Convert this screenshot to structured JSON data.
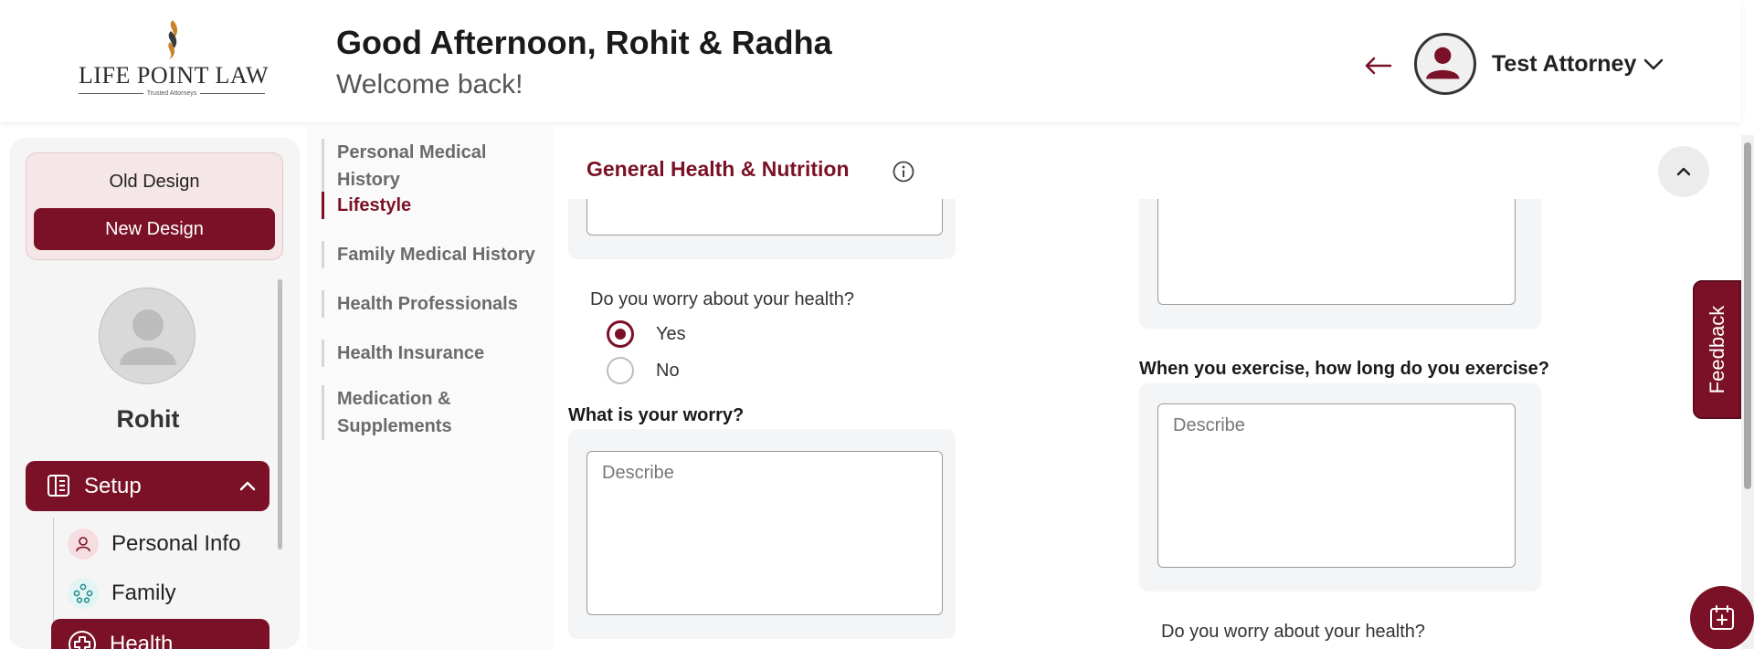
{
  "brand": {
    "logo_text": "LIFE POINT LAW",
    "logo_tagline": "Trusted Attorneys",
    "accent_color": "#7a1126"
  },
  "header": {
    "greeting": "Good Afternoon, Rohit & Radha",
    "welcome": "Welcome back!",
    "back_icon": "arrow-left-icon",
    "user_name": "Test Attorney",
    "user_menu_icon": "chevron-down-icon"
  },
  "sidebar": {
    "old_design": "Old Design",
    "new_design": "New Design",
    "profile_name": "Rohit",
    "setup": {
      "label": "Setup",
      "icon": "layout-icon",
      "expanded": true
    },
    "sub_items": [
      {
        "label": "Personal Info",
        "icon": "person-icon"
      },
      {
        "label": "Family",
        "icon": "family-icon"
      }
    ],
    "health": {
      "label": "Health",
      "icon": "medical-cross-icon"
    }
  },
  "section_nav": {
    "items": [
      {
        "label": "Personal Medical History",
        "active": false
      },
      {
        "label": "Lifestyle",
        "active": true
      },
      {
        "label": "Family Medical History",
        "active": false
      },
      {
        "label": "Health Professionals",
        "active": false
      },
      {
        "label": "Health Insurance",
        "active": false
      },
      {
        "label": "Medication & Supplements",
        "active": false
      }
    ]
  },
  "main": {
    "section_title": "General Health & Nutrition",
    "info_icon": "info-icon",
    "collapse_icon": "chevron-up-icon",
    "left": {
      "worry_question": "Do you worry about your health?",
      "worry_options": [
        {
          "label": "Yes",
          "selected": true
        },
        {
          "label": "No",
          "selected": false
        }
      ],
      "what_worry_label": "What is your worry?",
      "what_worry_placeholder": "Describe"
    },
    "right": {
      "exercise_length_label": "When you exercise, how long do you exercise?",
      "exercise_length_placeholder": "Describe",
      "worry_question_2": "Do you worry about your health?"
    }
  },
  "widgets": {
    "feedback": "Feedback",
    "calendar_icon": "calendar-plus-icon"
  }
}
